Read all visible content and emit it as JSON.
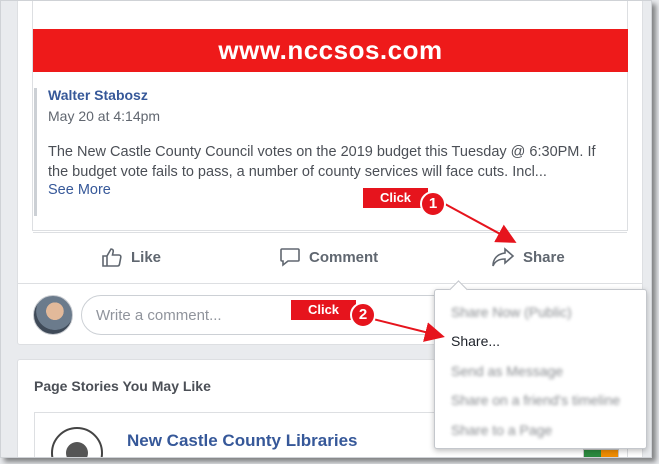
{
  "post": {
    "banner_text": "www.nccsos.com",
    "author": "Walter Stabosz",
    "date": "May 20 at 4:14pm",
    "body": "The New Castle County Council votes on the 2019 budget this Tuesday @ 6:30PM. If the budget vote fails to pass, a number of county services will face cuts. Incl...",
    "see_more": "See More"
  },
  "actions": {
    "like": "Like",
    "comment": "Comment",
    "share": "Share"
  },
  "comment_input": {
    "placeholder": "Write a comment..."
  },
  "share_menu": {
    "items": [
      {
        "label": "Share Now (Public)",
        "blurred": true
      },
      {
        "label": "Share...",
        "blurred": false
      },
      {
        "label": "Send as Message",
        "blurred": true
      },
      {
        "label": "Share on a friend's timeline",
        "blurred": true
      },
      {
        "label": "Share to a Page",
        "blurred": true
      }
    ]
  },
  "suggestions": {
    "title": "Page Stories You May Like",
    "page_name": "New Castle County Libraries"
  },
  "annotations": {
    "callout_1": {
      "text": "Click",
      "number": "1"
    },
    "callout_2": {
      "text": "Click",
      "number": "2"
    },
    "color": "#e6141d"
  }
}
